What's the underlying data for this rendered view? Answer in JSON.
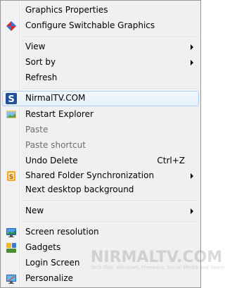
{
  "menu": {
    "items": [
      {
        "label": "Graphics Properties"
      },
      {
        "label": "Configure Switchable Graphics"
      },
      {
        "label": "View"
      },
      {
        "label": "Sort by"
      },
      {
        "label": "Refresh"
      },
      {
        "label": "NirmalTV.COM"
      },
      {
        "label": "Restart Explorer"
      },
      {
        "label": "Paste"
      },
      {
        "label": "Paste shortcut"
      },
      {
        "label": "Undo Delete",
        "shortcut": "Ctrl+Z"
      },
      {
        "label": "Shared Folder Synchronization"
      },
      {
        "label": "Next desktop background"
      },
      {
        "label": "New"
      },
      {
        "label": "Screen resolution"
      },
      {
        "label": "Gadgets"
      },
      {
        "label": "Login Screen"
      },
      {
        "label": "Personalize"
      }
    ]
  },
  "watermark": {
    "title": "NIRMALTV.COM",
    "tagline": "Tech Tips, Windows, Freeware, Social Media and Internet"
  },
  "colors": {
    "hover_border": "#aecff7",
    "menu_background": "#f0f0f0"
  }
}
